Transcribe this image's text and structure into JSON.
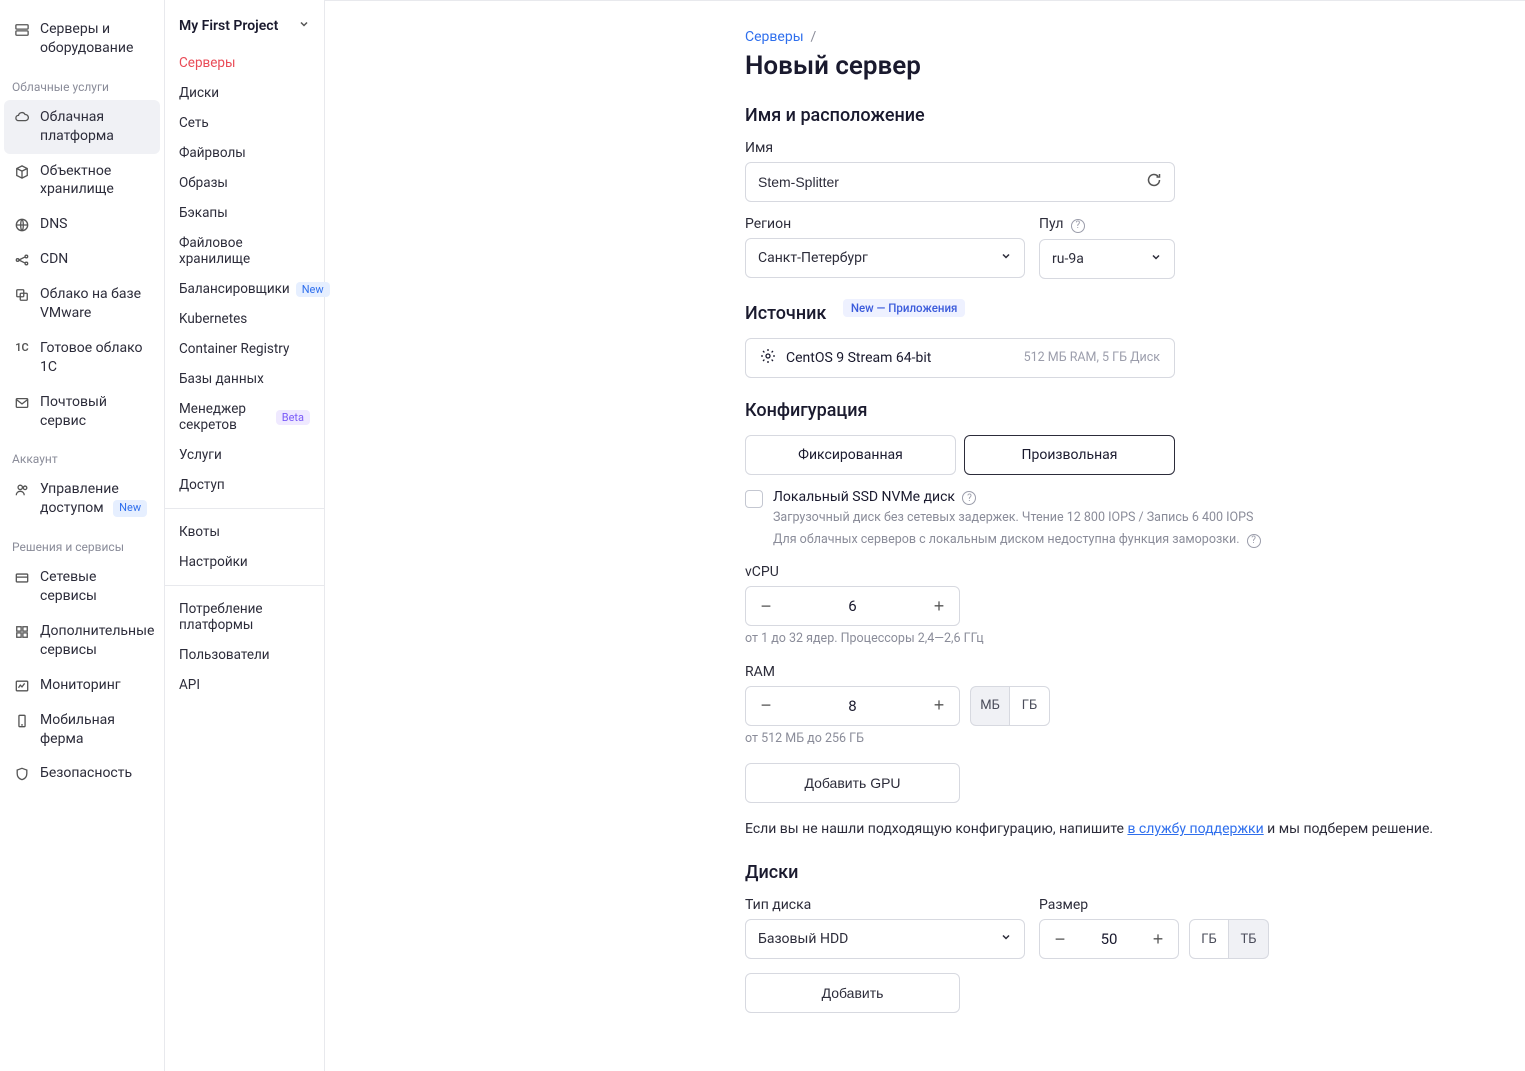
{
  "sidebar1": {
    "top": {
      "label": "Серверы и оборудование"
    },
    "groups": [
      {
        "header": "Облачные услуги",
        "items": [
          {
            "label": "Облачная платформа",
            "active": true
          },
          {
            "label": "Объектное хранилище"
          },
          {
            "label": "DNS"
          },
          {
            "label": "CDN"
          },
          {
            "label": "Облако на базе VMware"
          },
          {
            "label": "Готовое облако 1С"
          },
          {
            "label": "Почтовый сервис"
          }
        ]
      },
      {
        "header": "Аккаунт",
        "items": [
          {
            "label": "Управление доступом",
            "badge": "New"
          }
        ]
      },
      {
        "header": "Решения и сервисы",
        "items": [
          {
            "label": "Сетевые сервисы"
          },
          {
            "label": "Дополнительные сервисы"
          },
          {
            "label": "Мониторинг"
          },
          {
            "label": "Мобильная ферма"
          },
          {
            "label": "Безопасность"
          }
        ]
      }
    ]
  },
  "sidebar2": {
    "project": "My First Project",
    "groups": [
      [
        "Серверы",
        "Диски",
        "Сеть",
        "Файрволы",
        "Образы",
        "Бэкапы",
        "Файловое хранилище",
        "Балансировщики",
        "Kubernetes",
        "Container Registry",
        "Базы данных",
        "Менеджер секретов",
        "Услуги",
        "Доступ"
      ],
      [
        "Квоты",
        "Настройки"
      ],
      [
        "Потребление платформы",
        "Пользователи",
        "API"
      ]
    ],
    "active": "Серверы",
    "badges": {
      "Балансировщики": "New",
      "Менеджер секретов": "Beta"
    }
  },
  "breadcrumb": {
    "link": "Серверы",
    "sep": "/"
  },
  "pageTitle": "Новый сервер",
  "placement": {
    "title": "Имя и расположение",
    "nameLabel": "Имя",
    "nameValue": "Stem-Splitter",
    "regionLabel": "Регион",
    "regionValue": "Санкт-Петербург",
    "poolLabel": "Пул",
    "poolValue": "ru-9a"
  },
  "source": {
    "title": "Источник",
    "badge": "New — Приложения",
    "osName": "CentOS 9 Stream 64-bit",
    "meta": "512 МБ RAM, 5 ГБ Диск"
  },
  "config": {
    "title": "Конфигурация",
    "tabFixed": "Фиксированная",
    "tabCustom": "Произвольная",
    "localSsd": "Локальный SSD NVMe диск",
    "localSsdHint1": "Загрузочный диск без сетевых задержек. Чтение 12 800 IOPS / Запись 6 400 IOPS",
    "localSsdHint2": "Для облачных серверов с локальным диском недоступна функция заморозки.",
    "vcpuLabel": "vCPU",
    "vcpuValue": "6",
    "vcpuHint": "от 1 до 32 ядер. Процессоры 2,4—2,6 ГГц",
    "ramLabel": "RAM",
    "ramValue": "8",
    "ramUnitMb": "МБ",
    "ramUnitGb": "ГБ",
    "ramHint": "от 512 МБ до 256 ГБ",
    "addGpu": "Добавить GPU",
    "supportPrefix": "Если вы не нашли подходящую конфигурацию, напишите ",
    "supportLink": "в службу поддержки",
    "supportSuffix": " и мы подберем решение."
  },
  "disks": {
    "title": "Диски",
    "typeLabel": "Тип диска",
    "typeValue": "Базовый HDD",
    "sizeLabel": "Размер",
    "sizeValue": "50",
    "unitGb": "ГБ",
    "unitTb": "ТБ",
    "add": "Добавить"
  }
}
